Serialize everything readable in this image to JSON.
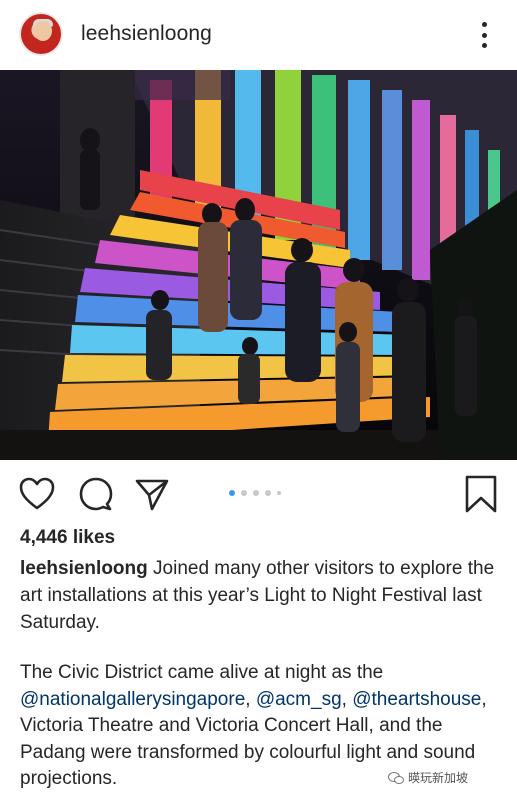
{
  "post": {
    "username": "leehsienloong",
    "likes": "4,446 likes",
    "caption_username": "leehsienloong",
    "caption_text": " Joined many other visitors to explore the art installations at this year’s Light to Night Festival last Saturday.",
    "para2_start": "The Civic District came alive at night as the ",
    "mention1": "@nationalgallerysingapore",
    "sep1": ", ",
    "mention2": "@acm_sg",
    "sep2": ", ",
    "mention3": "@theartshouse",
    "para2_end": ", Victoria Theatre and Victoria Concert Hall, and the Padang were transformed by colourful light and sound projections.",
    "carousel_count": 5,
    "carousel_active_index": 0
  },
  "icons": {
    "more": "more-vertical-icon",
    "like": "heart-icon",
    "comment": "comment-icon",
    "share": "paper-plane-icon",
    "save": "bookmark-icon"
  },
  "colors": {
    "text": "#262626",
    "carousel_active": "#3897f0",
    "carousel_inactive": "#c7c7c7"
  },
  "watermark": {
    "text": "暎玩新加坡"
  }
}
